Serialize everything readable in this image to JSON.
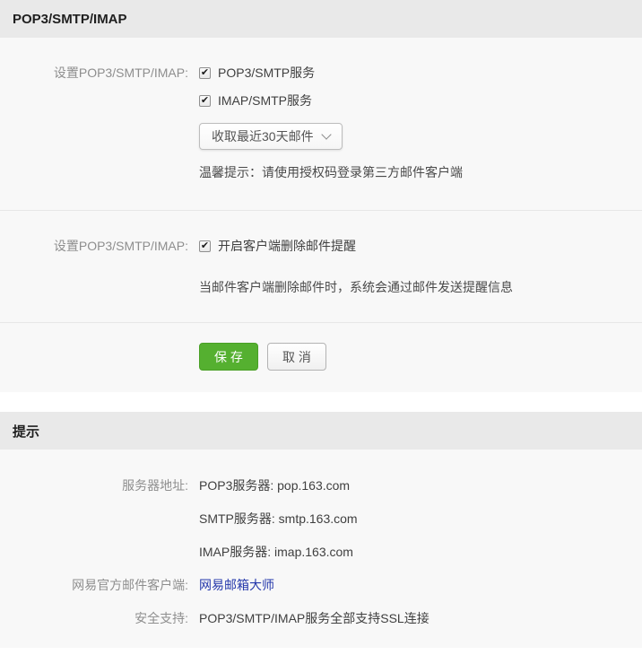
{
  "colors": {
    "header_bg": "#e9e9e9",
    "section_bg": "#f8f8f8",
    "save_green": "#55b030",
    "link_blue": "#2538ab"
  },
  "settings_section": {
    "title": "POP3/SMTP/IMAP",
    "row1": {
      "label": "设置POP3/SMTP/IMAP:",
      "checkbox_pop3": "POP3/SMTP服务",
      "checkbox_imap": "IMAP/SMTP服务",
      "check_glyph": "✔",
      "dropdown_value": "收取最近30天邮件",
      "hint": "温馨提示：请使用授权码登录第三方邮件客户端"
    },
    "row2": {
      "label": "设置POP3/SMTP/IMAP:",
      "checkbox_delete_notice": "开启客户端删除邮件提醒",
      "check_glyph": "✔",
      "description": "当邮件客户端删除邮件时，系统会通过邮件发送提醒信息"
    },
    "buttons": {
      "save": "保 存",
      "cancel": "取 消"
    }
  },
  "tips_section": {
    "title": "提示",
    "server_label": "服务器地址:",
    "servers": [
      "POP3服务器: pop.163.com",
      "SMTP服务器: smtp.163.com",
      "IMAP服务器: imap.163.com"
    ],
    "client_label": "网易官方邮件客户端:",
    "client_link": "网易邮箱大师",
    "security_label": "安全支持:",
    "security_value": "POP3/SMTP/IMAP服务全部支持SSL连接"
  }
}
